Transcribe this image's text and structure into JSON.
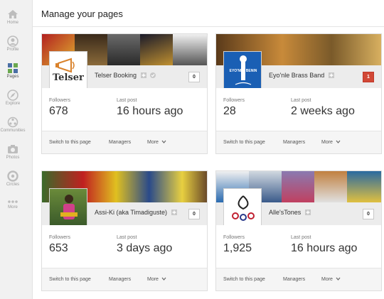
{
  "nav": {
    "items": [
      {
        "label": "Home",
        "icon": "home-icon"
      },
      {
        "label": "Profile",
        "icon": "profile-icon"
      },
      {
        "label": "Pages",
        "icon": "pages-icon"
      },
      {
        "label": "Explore",
        "icon": "explore-icon"
      },
      {
        "label": "Communities",
        "icon": "communities-icon"
      },
      {
        "label": "Photos",
        "icon": "photos-icon"
      },
      {
        "label": "Circles",
        "icon": "circles-icon"
      },
      {
        "label": "More",
        "icon": "more-icon"
      }
    ],
    "active": "Pages"
  },
  "header": {
    "title": "Manage your pages"
  },
  "labels": {
    "followers": "Followers",
    "last_post": "Last post",
    "switch": "Switch to this page",
    "managers": "Managers",
    "more": "More"
  },
  "pages": [
    {
      "name": "Telser Booking",
      "avatar_text": "Telser",
      "notification_count": "0",
      "followers": "678",
      "last_post": "16 hours ago"
    },
    {
      "name": "Eyo'nle Brass Band",
      "avatar_text": "EYO'NLE BENIN",
      "notification_count": "1",
      "followers": "28",
      "last_post": "2 weeks ago"
    },
    {
      "name": "Assi-Ki (aka Timadiguste)",
      "notification_count": "0",
      "followers": "653",
      "last_post": "3 days ago"
    },
    {
      "name": "Alle'sTones",
      "notification_count": "0",
      "followers": "1,925",
      "last_post": "16 hours ago"
    }
  ],
  "colors": {
    "notify_red": "#d14836",
    "nav_active": "#4a6fa5"
  }
}
